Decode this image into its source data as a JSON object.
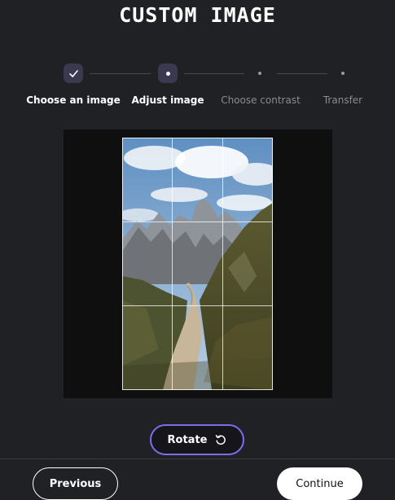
{
  "header": {
    "title": "CUSTOM IMAGE"
  },
  "stepper": {
    "steps": [
      {
        "label": "Choose an image",
        "state": "done"
      },
      {
        "label": "Adjust image",
        "state": "active"
      },
      {
        "label": "Choose contrast",
        "state": "pending"
      },
      {
        "label": "Transfer",
        "state": "pending"
      }
    ]
  },
  "editor": {
    "image_subject": "mountain trail photo",
    "grid": "rule-of-thirds"
  },
  "actions": {
    "rotate_label": "Rotate",
    "rotate_icon": "rotate-ccw-icon"
  },
  "footer": {
    "previous_label": "Previous",
    "continue_label": "Continue"
  },
  "colors": {
    "background": "#202124",
    "accent": "#7c6df0",
    "step_marker": "#3b3950"
  }
}
